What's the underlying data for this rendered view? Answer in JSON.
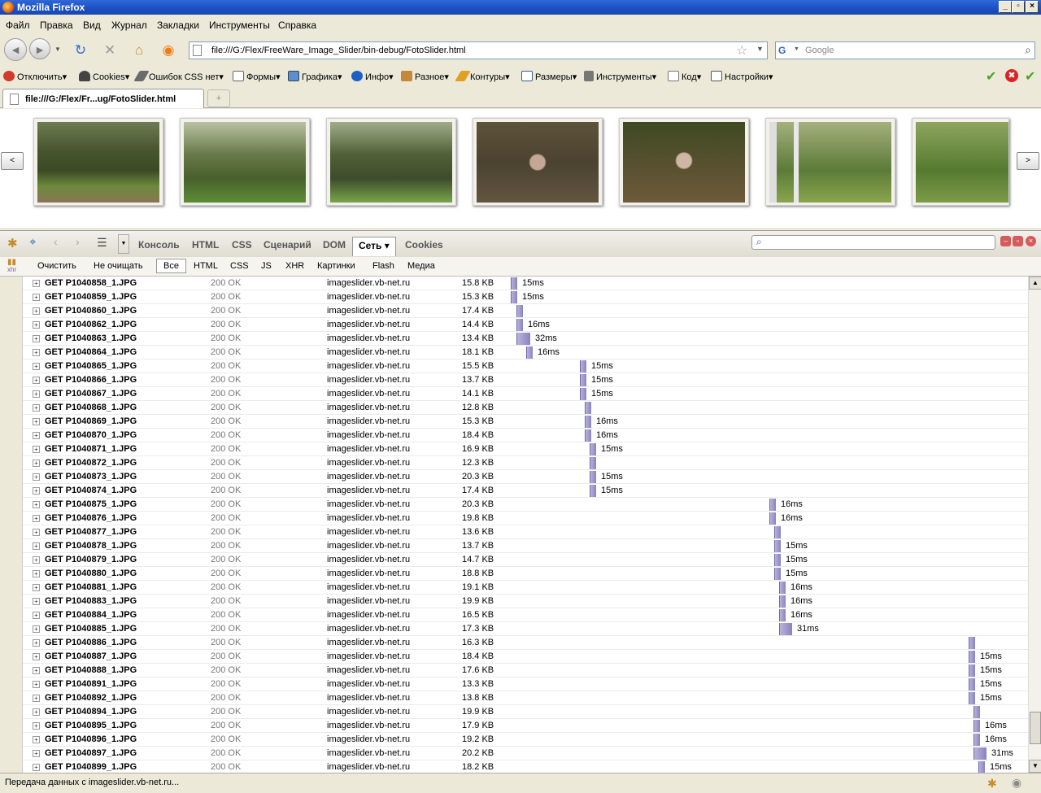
{
  "window": {
    "title": "Mozilla Firefox",
    "btn_min": "_",
    "btn_max": "▫",
    "btn_close": "×"
  },
  "menu": [
    "Файл",
    "Правка",
    "Вид",
    "Журнал",
    "Закладки",
    "Инструменты",
    "Справка"
  ],
  "nav": {
    "url": "file:///G:/Flex/FreeWare_Image_Slider/bin-debug/FotoSlider.html",
    "search_placeholder": "Google",
    "back_icon": "◄",
    "forward_icon": "►",
    "reload_icon": "↻",
    "stop_icon": "✕",
    "home_icon": "⌂",
    "rss_icon": "◉",
    "star_icon": "☆",
    "dropdown_icon": "▼",
    "magnifier_icon": "⌕"
  },
  "webdev_toolbar": {
    "items": [
      "Отключить",
      "Cookies",
      "Ошибок CSS нет",
      "Формы",
      "Графика",
      "Инфо",
      "Разное",
      "Контуры",
      "Размеры",
      "Инструменты",
      "Код",
      "Настройки"
    ],
    "colors": [
      "#d23a2a",
      "#444444",
      "#5d5d5d",
      "#6a6a6a",
      "#3a6fb5",
      "#1d5fc4",
      "#c48a3a",
      "#e0a020",
      "#3a5f8a",
      "#5a5a5a",
      "#7a7a7a",
      "#555555"
    ],
    "right_icons": [
      "✔",
      "✖",
      "✔"
    ]
  },
  "tab": {
    "title": "file:///G:/Flex/Fr...ug/FotoSlider.html",
    "new_tab": "+"
  },
  "slider": {
    "prev": "<",
    "next": ">"
  },
  "firebug": {
    "tabs": [
      "Консоль",
      "HTML",
      "CSS",
      "Сценарий",
      "DOM",
      "Сеть ▾",
      "Cookies"
    ],
    "selected_tab": "Сеть ▾",
    "search_icon": "⌕",
    "sub": [
      "Очистить",
      "Не очищать",
      "Все",
      "HTML",
      "CSS",
      "JS",
      "XHR",
      "Картинки",
      "Flash",
      "Медиа"
    ],
    "sub_selected": "Все",
    "xhr_icon": "xhr"
  },
  "requests": [
    {
      "url": "GET P1040858_1.JPG",
      "status": "200 OK",
      "domain": "imageslider.vb-net.ru",
      "size": "15.8 KB",
      "start": 600,
      "dur": 15,
      "time": "15ms"
    },
    {
      "url": "GET P1040859_1.JPG",
      "status": "200 OK",
      "domain": "imageslider.vb-net.ru",
      "size": "15.3 KB",
      "start": 600,
      "dur": 15,
      "time": "15ms"
    },
    {
      "url": "GET P1040860_1.JPG",
      "status": "200 OK",
      "domain": "imageslider.vb-net.ru",
      "size": "17.4 KB",
      "start": 607,
      "dur": 15,
      "time": ""
    },
    {
      "url": "GET P1040862_1.JPG",
      "status": "200 OK",
      "domain": "imageslider.vb-net.ru",
      "size": "14.4 KB",
      "start": 607,
      "dur": 16,
      "time": "16ms"
    },
    {
      "url": "GET P1040863_1.JPG",
      "status": "200 OK",
      "domain": "imageslider.vb-net.ru",
      "size": "13.4 KB",
      "start": 607,
      "dur": 32,
      "time": "32ms"
    },
    {
      "url": "GET P1040864_1.JPG",
      "status": "200 OK",
      "domain": "imageslider.vb-net.ru",
      "size": "18.1 KB",
      "start": 619,
      "dur": 16,
      "time": "16ms"
    },
    {
      "url": "GET P1040865_1.JPG",
      "status": "200 OK",
      "domain": "imageslider.vb-net.ru",
      "size": "15.5 KB",
      "start": 685,
      "dur": 15,
      "time": "15ms"
    },
    {
      "url": "GET P1040866_1.JPG",
      "status": "200 OK",
      "domain": "imageslider.vb-net.ru",
      "size": "13.7 KB",
      "start": 685,
      "dur": 15,
      "time": "15ms"
    },
    {
      "url": "GET P1040867_1.JPG",
      "status": "200 OK",
      "domain": "imageslider.vb-net.ru",
      "size": "14.1 KB",
      "start": 685,
      "dur": 15,
      "time": "15ms"
    },
    {
      "url": "GET P1040868_1.JPG",
      "status": "200 OK",
      "domain": "imageslider.vb-net.ru",
      "size": "12.8 KB",
      "start": 691,
      "dur": 15,
      "time": ""
    },
    {
      "url": "GET P1040869_1.JPG",
      "status": "200 OK",
      "domain": "imageslider.vb-net.ru",
      "size": "15.3 KB",
      "start": 691,
      "dur": 16,
      "time": "16ms"
    },
    {
      "url": "GET P1040870_1.JPG",
      "status": "200 OK",
      "domain": "imageslider.vb-net.ru",
      "size": "18.4 KB",
      "start": 691,
      "dur": 16,
      "time": "16ms"
    },
    {
      "url": "GET P1040871_1.JPG",
      "status": "200 OK",
      "domain": "imageslider.vb-net.ru",
      "size": "16.9 KB",
      "start": 697,
      "dur": 15,
      "time": "15ms"
    },
    {
      "url": "GET P1040872_1.JPG",
      "status": "200 OK",
      "domain": "imageslider.vb-net.ru",
      "size": "12.3 KB",
      "start": 697,
      "dur": 15,
      "time": ""
    },
    {
      "url": "GET P1040873_1.JPG",
      "status": "200 OK",
      "domain": "imageslider.vb-net.ru",
      "size": "20.3 KB",
      "start": 697,
      "dur": 15,
      "time": "15ms"
    },
    {
      "url": "GET P1040874_1.JPG",
      "status": "200 OK",
      "domain": "imageslider.vb-net.ru",
      "size": "17.4 KB",
      "start": 697,
      "dur": 15,
      "time": "15ms"
    },
    {
      "url": "GET P1040875_1.JPG",
      "status": "200 OK",
      "domain": "imageslider.vb-net.ru",
      "size": "20.3 KB",
      "start": 918,
      "dur": 16,
      "time": "16ms"
    },
    {
      "url": "GET P1040876_1.JPG",
      "status": "200 OK",
      "domain": "imageslider.vb-net.ru",
      "size": "19.8 KB",
      "start": 918,
      "dur": 16,
      "time": "16ms"
    },
    {
      "url": "GET P1040877_1.JPG",
      "status": "200 OK",
      "domain": "imageslider.vb-net.ru",
      "size": "13.6 KB",
      "start": 924,
      "dur": 15,
      "time": ""
    },
    {
      "url": "GET P1040878_1.JPG",
      "status": "200 OK",
      "domain": "imageslider.vb-net.ru",
      "size": "13.7 KB",
      "start": 924,
      "dur": 15,
      "time": "15ms"
    },
    {
      "url": "GET P1040879_1.JPG",
      "status": "200 OK",
      "domain": "imageslider.vb-net.ru",
      "size": "14.7 KB",
      "start": 924,
      "dur": 15,
      "time": "15ms"
    },
    {
      "url": "GET P1040880_1.JPG",
      "status": "200 OK",
      "domain": "imageslider.vb-net.ru",
      "size": "18.8 KB",
      "start": 924,
      "dur": 15,
      "time": "15ms"
    },
    {
      "url": "GET P1040881_1.JPG",
      "status": "200 OK",
      "domain": "imageslider.vb-net.ru",
      "size": "19.1 KB",
      "start": 930,
      "dur": 16,
      "time": "16ms"
    },
    {
      "url": "GET P1040883_1.JPG",
      "status": "200 OK",
      "domain": "imageslider.vb-net.ru",
      "size": "19.9 KB",
      "start": 930,
      "dur": 16,
      "time": "16ms"
    },
    {
      "url": "GET P1040884_1.JPG",
      "status": "200 OK",
      "domain": "imageslider.vb-net.ru",
      "size": "16.5 KB",
      "start": 930,
      "dur": 16,
      "time": "16ms"
    },
    {
      "url": "GET P1040885_1.JPG",
      "status": "200 OK",
      "domain": "imageslider.vb-net.ru",
      "size": "17.3 KB",
      "start": 930,
      "dur": 31,
      "time": "31ms"
    },
    {
      "url": "GET P1040886_1.JPG",
      "status": "200 OK",
      "domain": "imageslider.vb-net.ru",
      "size": "16.3 KB",
      "start": 1163,
      "dur": 15,
      "time": ""
    },
    {
      "url": "GET P1040887_1.JPG",
      "status": "200 OK",
      "domain": "imageslider.vb-net.ru",
      "size": "18.4 KB",
      "start": 1163,
      "dur": 15,
      "time": "15ms"
    },
    {
      "url": "GET P1040888_1.JPG",
      "status": "200 OK",
      "domain": "imageslider.vb-net.ru",
      "size": "17.6 KB",
      "start": 1163,
      "dur": 15,
      "time": "15ms"
    },
    {
      "url": "GET P1040891_1.JPG",
      "status": "200 OK",
      "domain": "imageslider.vb-net.ru",
      "size": "13.3 KB",
      "start": 1163,
      "dur": 15,
      "time": "15ms"
    },
    {
      "url": "GET P1040892_1.JPG",
      "status": "200 OK",
      "domain": "imageslider.vb-net.ru",
      "size": "13.8 KB",
      "start": 1163,
      "dur": 15,
      "time": "15ms"
    },
    {
      "url": "GET P1040894_1.JPG",
      "status": "200 OK",
      "domain": "imageslider.vb-net.ru",
      "size": "19.9 KB",
      "start": 1169,
      "dur": 15,
      "time": ""
    },
    {
      "url": "GET P1040895_1.JPG",
      "status": "200 OK",
      "domain": "imageslider.vb-net.ru",
      "size": "17.9 KB",
      "start": 1169,
      "dur": 16,
      "time": "16ms"
    },
    {
      "url": "GET P1040896_1.JPG",
      "status": "200 OK",
      "domain": "imageslider.vb-net.ru",
      "size": "19.2 KB",
      "start": 1169,
      "dur": 16,
      "time": "16ms"
    },
    {
      "url": "GET P1040897_1.JPG",
      "status": "200 OK",
      "domain": "imageslider.vb-net.ru",
      "size": "20.2 KB",
      "start": 1169,
      "dur": 31,
      "time": "31ms"
    },
    {
      "url": "GET P1040899_1.JPG",
      "status": "200 OK",
      "domain": "imageslider.vb-net.ru",
      "size": "18.2 KB",
      "start": 1175,
      "dur": 15,
      "time": "15ms"
    }
  ],
  "statusbar": {
    "text": "Передача данных с imageslider.vb-net.ru..."
  }
}
